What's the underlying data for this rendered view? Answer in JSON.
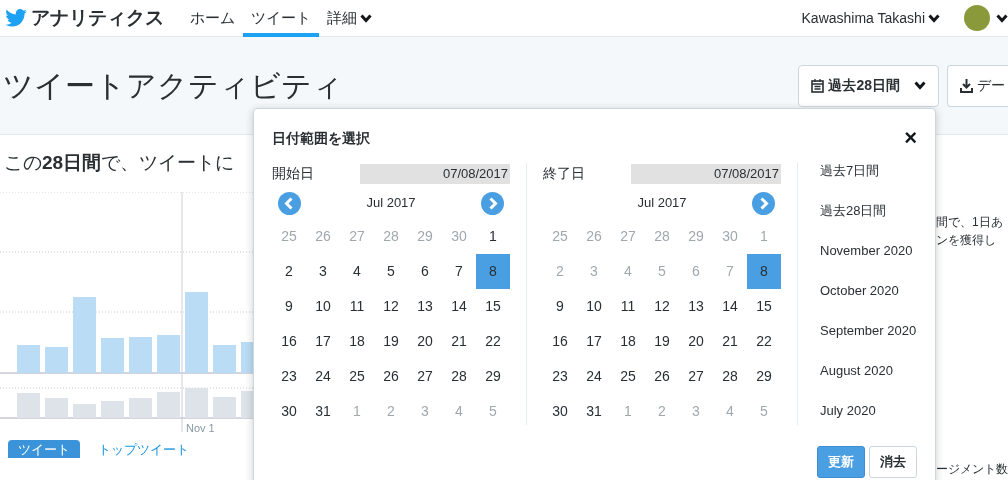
{
  "navbar": {
    "brand": "アナリティクス",
    "items": [
      {
        "label": "ホーム",
        "selected": false,
        "dropdown": false
      },
      {
        "label": "ツイート",
        "selected": true,
        "dropdown": false
      },
      {
        "label": "詳細",
        "selected": false,
        "dropdown": true
      }
    ],
    "user": "Kawashima Takashi"
  },
  "header": {
    "title": "ツイートアクティビティ",
    "date_button": "過去28日間",
    "download_button": "デー"
  },
  "summary": {
    "headline": "この**28日間**で、ツイートに",
    "chart_label": "Nov 1",
    "side_texts": [
      "間で、1日あ",
      "ンを獲得し"
    ],
    "bottom_text": "ージメント数"
  },
  "tweet_tabs": [
    {
      "label": "ツイート",
      "selected": true
    },
    {
      "label": "トップツイート",
      "selected": false
    }
  ],
  "date_picker": {
    "title": "日付範囲を選択",
    "close": "×",
    "calendars": [
      {
        "label": "開始日",
        "value": "07/08/2017",
        "month": "Jul 2017",
        "has_prev": true,
        "has_next": true,
        "weeks": [
          [
            {
              "day": "25",
              "muted": true,
              "selected": false
            },
            {
              "day": "26",
              "muted": true,
              "selected": false
            },
            {
              "day": "27",
              "muted": true,
              "selected": false
            },
            {
              "day": "28",
              "muted": true,
              "selected": false
            },
            {
              "day": "29",
              "muted": true,
              "selected": false
            },
            {
              "day": "30",
              "muted": true,
              "selected": false
            },
            {
              "day": "1",
              "muted": false,
              "selected": false
            }
          ],
          [
            {
              "day": "2",
              "muted": false,
              "selected": false
            },
            {
              "day": "3",
              "muted": false,
              "selected": false
            },
            {
              "day": "4",
              "muted": false,
              "selected": false
            },
            {
              "day": "5",
              "muted": false,
              "selected": false
            },
            {
              "day": "6",
              "muted": false,
              "selected": false
            },
            {
              "day": "7",
              "muted": false,
              "selected": false
            },
            {
              "day": "8",
              "muted": false,
              "selected": true
            }
          ],
          [
            {
              "day": "9",
              "muted": false,
              "selected": false
            },
            {
              "day": "10",
              "muted": false,
              "selected": false
            },
            {
              "day": "11",
              "muted": false,
              "selected": false
            },
            {
              "day": "12",
              "muted": false,
              "selected": false
            },
            {
              "day": "13",
              "muted": false,
              "selected": false
            },
            {
              "day": "14",
              "muted": false,
              "selected": false
            },
            {
              "day": "15",
              "muted": false,
              "selected": false
            }
          ],
          [
            {
              "day": "16",
              "muted": false,
              "selected": false
            },
            {
              "day": "17",
              "muted": false,
              "selected": false
            },
            {
              "day": "18",
              "muted": false,
              "selected": false
            },
            {
              "day": "19",
              "muted": false,
              "selected": false
            },
            {
              "day": "20",
              "muted": false,
              "selected": false
            },
            {
              "day": "21",
              "muted": false,
              "selected": false
            },
            {
              "day": "22",
              "muted": false,
              "selected": false
            }
          ],
          [
            {
              "day": "23",
              "muted": false,
              "selected": false
            },
            {
              "day": "24",
              "muted": false,
              "selected": false
            },
            {
              "day": "25",
              "muted": false,
              "selected": false
            },
            {
              "day": "26",
              "muted": false,
              "selected": false
            },
            {
              "day": "27",
              "muted": false,
              "selected": false
            },
            {
              "day": "28",
              "muted": false,
              "selected": false
            },
            {
              "day": "29",
              "muted": false,
              "selected": false
            }
          ],
          [
            {
              "day": "30",
              "muted": false,
              "selected": false
            },
            {
              "day": "31",
              "muted": false,
              "selected": false
            },
            {
              "day": "1",
              "muted": true,
              "selected": false
            },
            {
              "day": "2",
              "muted": true,
              "selected": false
            },
            {
              "day": "3",
              "muted": true,
              "selected": false
            },
            {
              "day": "4",
              "muted": true,
              "selected": false
            },
            {
              "day": "5",
              "muted": true,
              "selected": false
            }
          ]
        ]
      },
      {
        "label": "終了日",
        "value": "07/08/2017",
        "month": "Jul 2017",
        "has_prev": false,
        "has_next": true,
        "weeks": [
          [
            {
              "day": "25",
              "muted": true,
              "selected": false
            },
            {
              "day": "26",
              "muted": true,
              "selected": false
            },
            {
              "day": "27",
              "muted": true,
              "selected": false
            },
            {
              "day": "28",
              "muted": true,
              "selected": false
            },
            {
              "day": "29",
              "muted": true,
              "selected": false
            },
            {
              "day": "30",
              "muted": true,
              "selected": false
            },
            {
              "day": "1",
              "muted": true,
              "selected": false
            }
          ],
          [
            {
              "day": "2",
              "muted": true,
              "selected": false
            },
            {
              "day": "3",
              "muted": true,
              "selected": false
            },
            {
              "day": "4",
              "muted": true,
              "selected": false
            },
            {
              "day": "5",
              "muted": true,
              "selected": false
            },
            {
              "day": "6",
              "muted": true,
              "selected": false
            },
            {
              "day": "7",
              "muted": true,
              "selected": false
            },
            {
              "day": "8",
              "muted": false,
              "selected": true
            }
          ],
          [
            {
              "day": "9",
              "muted": false,
              "selected": false
            },
            {
              "day": "10",
              "muted": false,
              "selected": false
            },
            {
              "day": "11",
              "muted": false,
              "selected": false
            },
            {
              "day": "12",
              "muted": false,
              "selected": false
            },
            {
              "day": "13",
              "muted": false,
              "selected": false
            },
            {
              "day": "14",
              "muted": false,
              "selected": false
            },
            {
              "day": "15",
              "muted": false,
              "selected": false
            }
          ],
          [
            {
              "day": "16",
              "muted": false,
              "selected": false
            },
            {
              "day": "17",
              "muted": false,
              "selected": false
            },
            {
              "day": "18",
              "muted": false,
              "selected": false
            },
            {
              "day": "19",
              "muted": false,
              "selected": false
            },
            {
              "day": "20",
              "muted": false,
              "selected": false
            },
            {
              "day": "21",
              "muted": false,
              "selected": false
            },
            {
              "day": "22",
              "muted": false,
              "selected": false
            }
          ],
          [
            {
              "day": "23",
              "muted": false,
              "selected": false
            },
            {
              "day": "24",
              "muted": false,
              "selected": false
            },
            {
              "day": "25",
              "muted": false,
              "selected": false
            },
            {
              "day": "26",
              "muted": false,
              "selected": false
            },
            {
              "day": "27",
              "muted": false,
              "selected": false
            },
            {
              "day": "28",
              "muted": false,
              "selected": false
            },
            {
              "day": "29",
              "muted": false,
              "selected": false
            }
          ],
          [
            {
              "day": "30",
              "muted": false,
              "selected": false
            },
            {
              "day": "31",
              "muted": false,
              "selected": false
            },
            {
              "day": "1",
              "muted": true,
              "selected": false
            },
            {
              "day": "2",
              "muted": true,
              "selected": false
            },
            {
              "day": "3",
              "muted": true,
              "selected": false
            },
            {
              "day": "4",
              "muted": true,
              "selected": false
            },
            {
              "day": "5",
              "muted": true,
              "selected": false
            }
          ]
        ]
      }
    ],
    "presets": [
      "過去7日間",
      "過去28日間",
      "November 2020",
      "October 2020",
      "September 2020",
      "August 2020",
      "July 2020"
    ],
    "apply_button": "更新",
    "clear_button": "消去"
  }
}
